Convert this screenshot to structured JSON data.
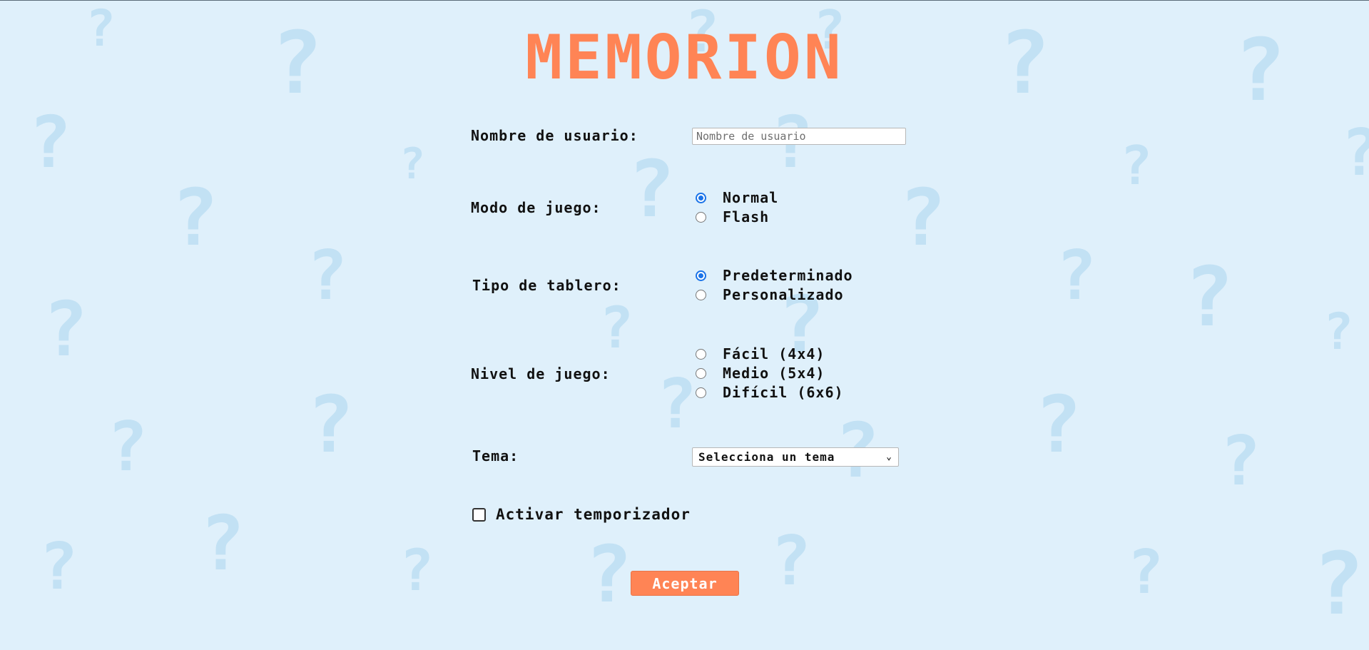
{
  "title": "MEMORION",
  "background": {
    "color": "#dff0fb",
    "pattern_icon": "question-mark-icon",
    "pattern_color": "#b9dcf2"
  },
  "accent_color": "#ff8455",
  "form": {
    "username": {
      "label": "Nombre de usuario:",
      "placeholder": "Nombre de usuario",
      "value": ""
    },
    "game_mode": {
      "label": "Modo de juego:",
      "options": [
        {
          "label": "Normal",
          "checked": true
        },
        {
          "label": "Flash",
          "checked": false
        }
      ]
    },
    "board_type": {
      "label": "Tipo de tablero:",
      "options": [
        {
          "label": "Predeterminado",
          "checked": true
        },
        {
          "label": "Personalizado",
          "checked": false
        }
      ]
    },
    "level": {
      "label": "Nivel de juego:",
      "options": [
        {
          "label": "Fácil (4x4)",
          "checked": false
        },
        {
          "label": "Medio (5x4)",
          "checked": false
        },
        {
          "label": "Difícil (6x6)",
          "checked": false
        }
      ]
    },
    "theme": {
      "label": "Tema:",
      "selected": "Selecciona un tema"
    },
    "timer": {
      "label": "Activar temporizador",
      "checked": false
    },
    "submit_label": "Aceptar"
  }
}
